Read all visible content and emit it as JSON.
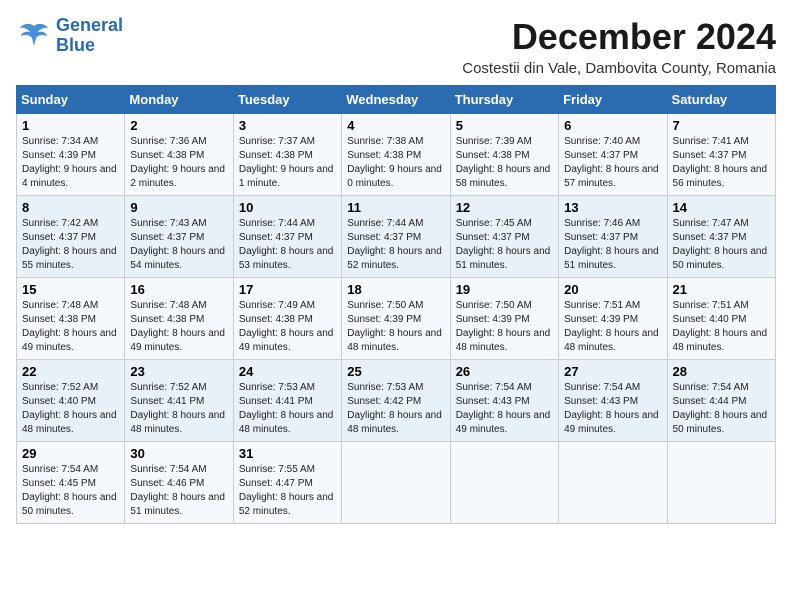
{
  "logo": {
    "line1": "General",
    "line2": "Blue"
  },
  "title": "December 2024",
  "location": "Costestii din Vale, Dambovita County, Romania",
  "days_of_week": [
    "Sunday",
    "Monday",
    "Tuesday",
    "Wednesday",
    "Thursday",
    "Friday",
    "Saturday"
  ],
  "weeks": [
    [
      {
        "day": "1",
        "sunrise": "7:34 AM",
        "sunset": "4:39 PM",
        "daylight": "9 hours and 4 minutes."
      },
      {
        "day": "2",
        "sunrise": "7:36 AM",
        "sunset": "4:38 PM",
        "daylight": "9 hours and 2 minutes."
      },
      {
        "day": "3",
        "sunrise": "7:37 AM",
        "sunset": "4:38 PM",
        "daylight": "9 hours and 1 minute."
      },
      {
        "day": "4",
        "sunrise": "7:38 AM",
        "sunset": "4:38 PM",
        "daylight": "9 hours and 0 minutes."
      },
      {
        "day": "5",
        "sunrise": "7:39 AM",
        "sunset": "4:38 PM",
        "daylight": "8 hours and 58 minutes."
      },
      {
        "day": "6",
        "sunrise": "7:40 AM",
        "sunset": "4:37 PM",
        "daylight": "8 hours and 57 minutes."
      },
      {
        "day": "7",
        "sunrise": "7:41 AM",
        "sunset": "4:37 PM",
        "daylight": "8 hours and 56 minutes."
      }
    ],
    [
      {
        "day": "8",
        "sunrise": "7:42 AM",
        "sunset": "4:37 PM",
        "daylight": "8 hours and 55 minutes."
      },
      {
        "day": "9",
        "sunrise": "7:43 AM",
        "sunset": "4:37 PM",
        "daylight": "8 hours and 54 minutes."
      },
      {
        "day": "10",
        "sunrise": "7:44 AM",
        "sunset": "4:37 PM",
        "daylight": "8 hours and 53 minutes."
      },
      {
        "day": "11",
        "sunrise": "7:44 AM",
        "sunset": "4:37 PM",
        "daylight": "8 hours and 52 minutes."
      },
      {
        "day": "12",
        "sunrise": "7:45 AM",
        "sunset": "4:37 PM",
        "daylight": "8 hours and 51 minutes."
      },
      {
        "day": "13",
        "sunrise": "7:46 AM",
        "sunset": "4:37 PM",
        "daylight": "8 hours and 51 minutes."
      },
      {
        "day": "14",
        "sunrise": "7:47 AM",
        "sunset": "4:37 PM",
        "daylight": "8 hours and 50 minutes."
      }
    ],
    [
      {
        "day": "15",
        "sunrise": "7:48 AM",
        "sunset": "4:38 PM",
        "daylight": "8 hours and 49 minutes."
      },
      {
        "day": "16",
        "sunrise": "7:48 AM",
        "sunset": "4:38 PM",
        "daylight": "8 hours and 49 minutes."
      },
      {
        "day": "17",
        "sunrise": "7:49 AM",
        "sunset": "4:38 PM",
        "daylight": "8 hours and 49 minutes."
      },
      {
        "day": "18",
        "sunrise": "7:50 AM",
        "sunset": "4:39 PM",
        "daylight": "8 hours and 48 minutes."
      },
      {
        "day": "19",
        "sunrise": "7:50 AM",
        "sunset": "4:39 PM",
        "daylight": "8 hours and 48 minutes."
      },
      {
        "day": "20",
        "sunrise": "7:51 AM",
        "sunset": "4:39 PM",
        "daylight": "8 hours and 48 minutes."
      },
      {
        "day": "21",
        "sunrise": "7:51 AM",
        "sunset": "4:40 PM",
        "daylight": "8 hours and 48 minutes."
      }
    ],
    [
      {
        "day": "22",
        "sunrise": "7:52 AM",
        "sunset": "4:40 PM",
        "daylight": "8 hours and 48 minutes."
      },
      {
        "day": "23",
        "sunrise": "7:52 AM",
        "sunset": "4:41 PM",
        "daylight": "8 hours and 48 minutes."
      },
      {
        "day": "24",
        "sunrise": "7:53 AM",
        "sunset": "4:41 PM",
        "daylight": "8 hours and 48 minutes."
      },
      {
        "day": "25",
        "sunrise": "7:53 AM",
        "sunset": "4:42 PM",
        "daylight": "8 hours and 48 minutes."
      },
      {
        "day": "26",
        "sunrise": "7:54 AM",
        "sunset": "4:43 PM",
        "daylight": "8 hours and 49 minutes."
      },
      {
        "day": "27",
        "sunrise": "7:54 AM",
        "sunset": "4:43 PM",
        "daylight": "8 hours and 49 minutes."
      },
      {
        "day": "28",
        "sunrise": "7:54 AM",
        "sunset": "4:44 PM",
        "daylight": "8 hours and 50 minutes."
      }
    ],
    [
      {
        "day": "29",
        "sunrise": "7:54 AM",
        "sunset": "4:45 PM",
        "daylight": "8 hours and 50 minutes."
      },
      {
        "day": "30",
        "sunrise": "7:54 AM",
        "sunset": "4:46 PM",
        "daylight": "8 hours and 51 minutes."
      },
      {
        "day": "31",
        "sunrise": "7:55 AM",
        "sunset": "4:47 PM",
        "daylight": "8 hours and 52 minutes."
      },
      null,
      null,
      null,
      null
    ]
  ]
}
